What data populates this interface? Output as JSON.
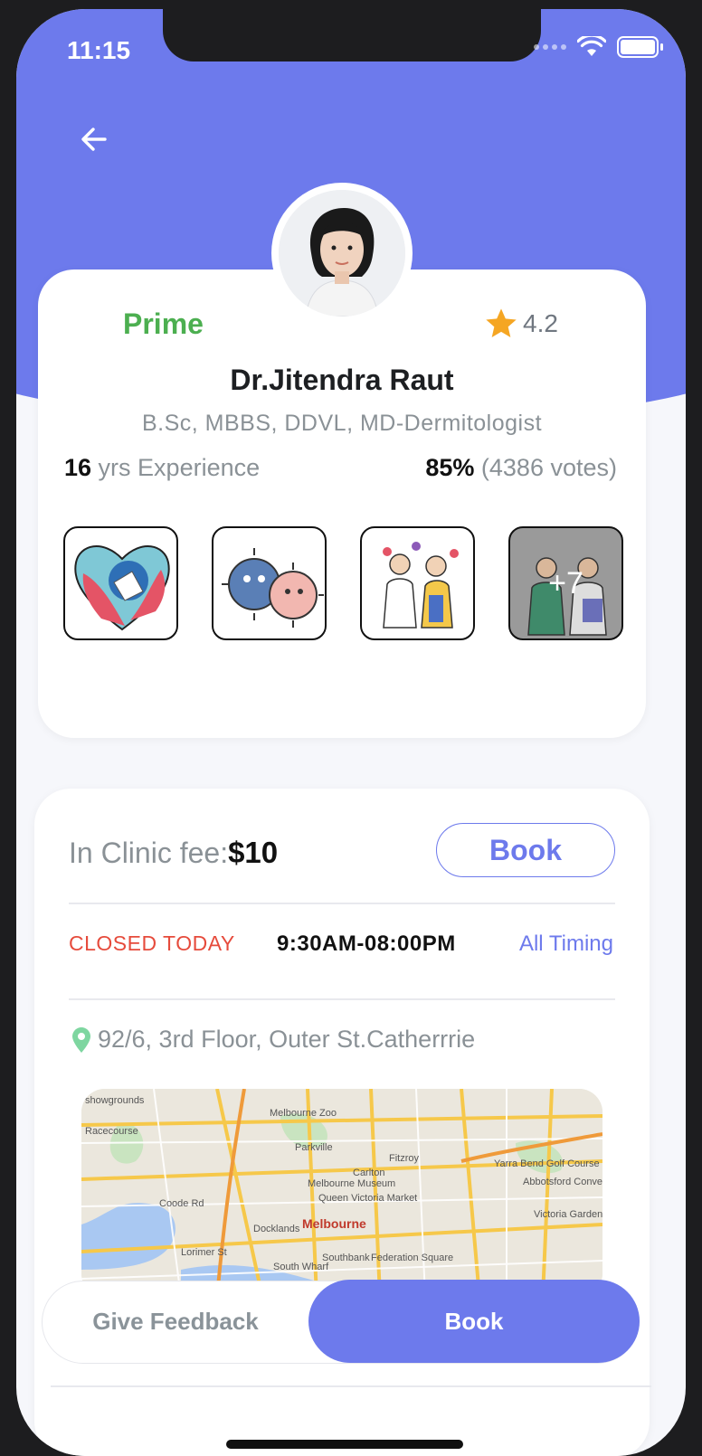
{
  "status_bar": {
    "time": "11:15"
  },
  "doctor": {
    "badge": "Prime",
    "rating": "4.2",
    "name": "Dr.Jitendra Raut",
    "degrees": "B.Sc, MBBS, DDVL, MD-Dermitologist",
    "experience_value": "16",
    "experience_label": " yrs Experience",
    "votes_percent": "85%",
    "votes_count": " (4386 votes)",
    "gallery_more": "+7"
  },
  "clinic": {
    "fee_label": "In Clinic fee:",
    "fee_value": "$10",
    "book_label": "Book",
    "status": "CLOSED TODAY",
    "hours": "9:30AM-08:00PM",
    "all_timing": "All Timing",
    "address": "92/6, 3rd Floor, Outer St.Catherrrie",
    "map": {
      "labels": [
        "Melbourne Zoo",
        "Parkville",
        "Carlton",
        "Fitzroy",
        "Melbourne Museum",
        "Queen Victoria Market",
        "Docklands",
        "Melbourne",
        "Federation Square",
        "Southbank",
        "Abbotsford Convent",
        "Victoria Gardens",
        "Yarra Bend Golf Course",
        "Racecourse",
        "showgrounds",
        "Coode Rd",
        "South Wharf",
        "Lorimer St"
      ]
    }
  },
  "actions": {
    "feedback_label": "Give Feedback",
    "book_label": "Book"
  },
  "colors": {
    "accent": "#6d7aec",
    "prime": "#4caf50",
    "closed": "#e64b3c",
    "star": "#f5a623"
  }
}
